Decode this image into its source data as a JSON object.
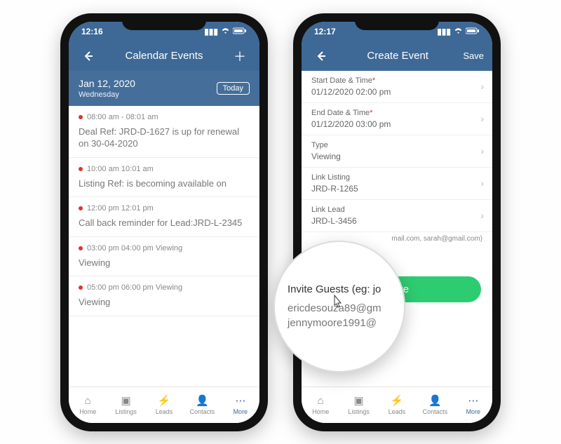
{
  "left": {
    "time": "12:16",
    "title": "Calendar Events",
    "dateHeader": {
      "date": "Jan 12, 2020",
      "dow": "Wednesday",
      "today": "Today"
    },
    "events": [
      {
        "time": "08:00 am - 08:01 am",
        "desc": "Deal Ref: JRD-D-1627 is up for renewal on 30-04-2020"
      },
      {
        "time": "10:00 am 10:01 am",
        "desc": "Listing Ref: is becoming available on"
      },
      {
        "time": "12:00 pm 12:01 pm",
        "desc": "Call back reminder for Lead:JRD-L-2345"
      },
      {
        "time": "03:00 pm 04:00 pm Viewing",
        "desc": "Viewing"
      },
      {
        "time": "05:00 pm 06:00 pm Viewing",
        "desc": "Viewing"
      }
    ]
  },
  "right": {
    "time": "12:17",
    "title": "Create Event",
    "saveTop": "Save",
    "fields": [
      {
        "label": "Start Date & Time",
        "req": true,
        "value": "01/12/2020 02:00 pm"
      },
      {
        "label": "End Date & Time",
        "req": true,
        "value": "01/12/2020 03:00 pm"
      },
      {
        "label": "Type",
        "req": false,
        "value": "Viewing"
      },
      {
        "label": "Link Listing",
        "req": false,
        "value": "JRD-R-1265"
      },
      {
        "label": "Link Lead",
        "req": false,
        "value": "JRD-L-3456"
      }
    ],
    "hint": "mail.com, sarah@gmail.com)",
    "saveBtn": "Save",
    "magnifier": {
      "label": "Invite Guests (eg: jo",
      "emails": [
        "ericdesouza89@gm",
        "jennymoore1991@"
      ]
    }
  },
  "tabs": [
    {
      "label": "Home",
      "icon": "⌂"
    },
    {
      "label": "Listings",
      "icon": "▣"
    },
    {
      "label": "Leads",
      "icon": "⚡"
    },
    {
      "label": "Contacts",
      "icon": "👤"
    },
    {
      "label": "More",
      "icon": "⋯"
    }
  ],
  "star": "*"
}
